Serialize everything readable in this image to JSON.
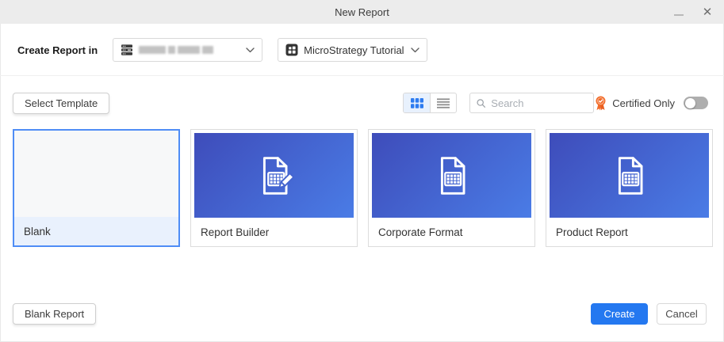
{
  "window": {
    "title": "New Report",
    "controls": {
      "minimize": "",
      "close": "✕"
    }
  },
  "header": {
    "label": "Create Report in",
    "server_dropdown": {
      "value": "",
      "redacted": true,
      "icon": "server-icon"
    },
    "project_dropdown": {
      "value": "MicroStrategy Tutorial",
      "icon": "project-grid-icon"
    }
  },
  "toolbar": {
    "select_template_label": "Select Template",
    "view_mode": "grid",
    "search": {
      "placeholder": "Search",
      "value": ""
    },
    "certified_label": "Certified Only",
    "certified_toggle_state": "off"
  },
  "templates": [
    {
      "name": "Blank",
      "selected": true,
      "thumbnail": "blank"
    },
    {
      "name": "Report Builder",
      "selected": false,
      "thumbnail": "document-table-pencil"
    },
    {
      "name": "Corporate Format",
      "selected": false,
      "thumbnail": "document-table"
    },
    {
      "name": "Product Report",
      "selected": false,
      "thumbnail": "document-table"
    }
  ],
  "footer": {
    "blank_report_label": "Blank Report",
    "create_label": "Create",
    "cancel_label": "Cancel"
  },
  "colors": {
    "accent_blue": "#2478f0",
    "card_gradient_start": "#3e4cba",
    "card_gradient_end": "#4a7ce6",
    "selected_border": "#4f8df6",
    "selected_label_bg": "#e9f1fd",
    "certified_orange": "#f26b29",
    "titlebar_bg": "#ececec"
  }
}
